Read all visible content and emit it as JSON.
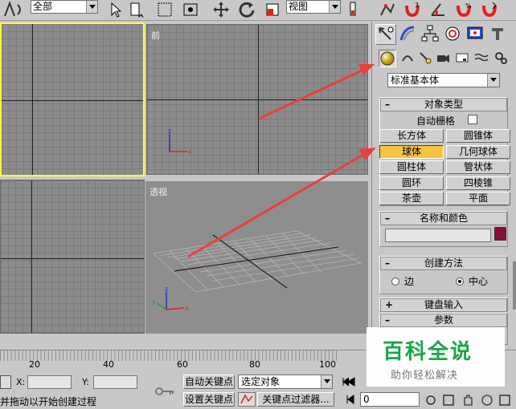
{
  "toolbar": {
    "selection_filter": "全部",
    "reference_coord": "视图"
  },
  "viewports": {
    "top_left_label": "",
    "front_label": "前",
    "left_label": "",
    "perspective_label": "透视"
  },
  "command_panel": {
    "category_dropdown": "标准基本体",
    "object_type": {
      "header": "对象类型",
      "autogrid_label": "自动栅格",
      "buttons": [
        "长方体",
        "圆锥体",
        "球体",
        "几何球体",
        "圆柱体",
        "管状体",
        "圆环",
        "四棱锥",
        "茶壶",
        "平面"
      ],
      "active_button": "球体"
    },
    "name_color": {
      "header": "名称和颜色",
      "color": "#8b0f3a"
    },
    "creation_method": {
      "header": "创建方法",
      "options": [
        "边",
        "中心"
      ],
      "selected": "中心"
    },
    "keyboard_entry": {
      "header": "键盘输入"
    },
    "parameters": {
      "header": "参数"
    }
  },
  "timeline": {
    "ticks": [
      "20",
      "40",
      "60",
      "80",
      "100"
    ]
  },
  "status_bar": {
    "x_label": "X:",
    "y_label": "Y:",
    "auto_key": "自动关键点",
    "set_key": "设置关键点",
    "selected_object": "选定对象",
    "key_filters": "关键点过滤器...",
    "frame_value": "0",
    "prompt": "并拖动以开始创建过程"
  },
  "watermark": {
    "title": "百科全说",
    "subtitle": "助你轻松解决"
  },
  "colors": {
    "active_button": "#f5c343",
    "selected_viewport_border": "#ffff3a",
    "arrow": "#e8403a",
    "watermark_green": "#1aa64a"
  }
}
